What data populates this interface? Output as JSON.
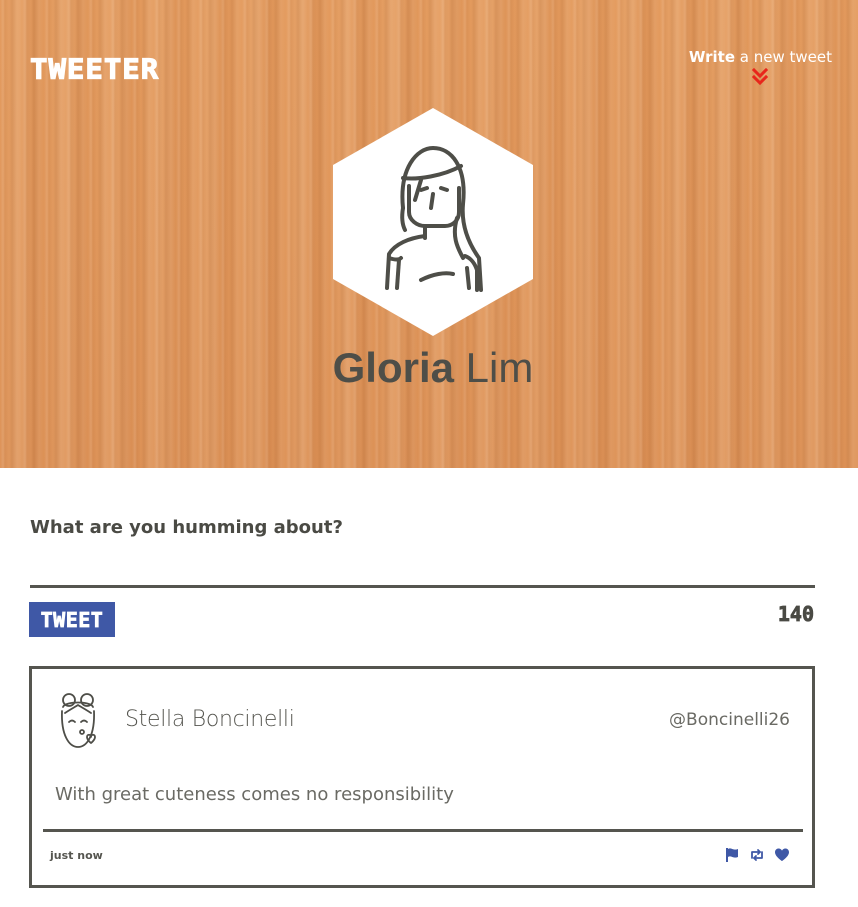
{
  "header": {
    "logo": "TWEETER",
    "write_bold": "Write",
    "write_rest": " a new tweet",
    "write_icon": "double-chevron-down-icon",
    "accent_color": "#e8261b"
  },
  "profile": {
    "first_name": "Gloria",
    "last_name": " Lim",
    "avatar_icon": "woman-avatar-icon"
  },
  "compose": {
    "label": "What are you humming about?",
    "input_value": "",
    "button_label": "TWEET",
    "char_count": "140",
    "button_color": "#3f58a6"
  },
  "tweets": [
    {
      "avatar_icon": "girl-blowing-kiss-avatar-icon",
      "name": "Stella Boncinelli",
      "handle": "@Boncinelli26",
      "text": "With great cuteness comes no responsibility",
      "time": "just now",
      "actions": [
        "flag-icon",
        "retweet-icon",
        "heart-icon"
      ]
    }
  ],
  "colors": {
    "banner": "#e0965a",
    "text_dark": "#4a4a44",
    "action_icons": "#3f58a6"
  }
}
